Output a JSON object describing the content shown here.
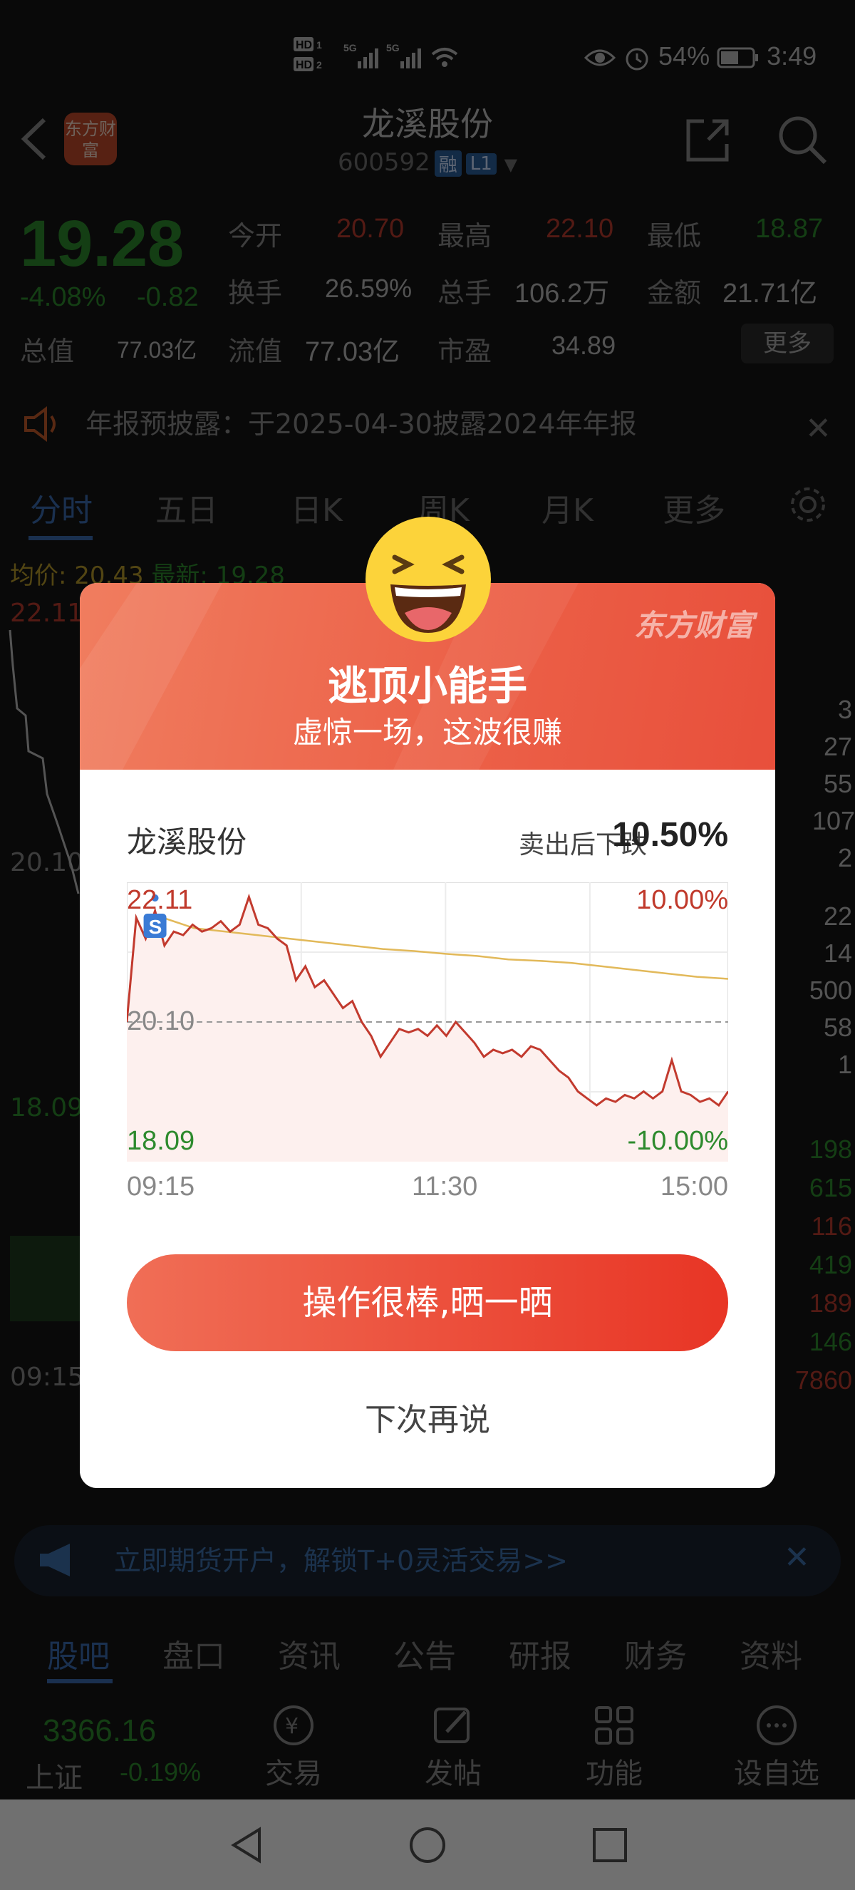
{
  "status_bar": {
    "network": "HD 5G 5G",
    "battery": "54%",
    "time": "3:49"
  },
  "header": {
    "stock_name": "龙溪股份",
    "stock_code": "600592",
    "tag_rong": "融",
    "tag_l1": "L1",
    "logo_text": "东方财富"
  },
  "quote": {
    "price": "19.28",
    "change_pct": "-4.08%",
    "change": "-0.82",
    "open_label": "今开",
    "open": "20.70",
    "high_label": "最高",
    "high": "22.10",
    "low_label": "最低",
    "low": "18.87",
    "turnover_label": "换手",
    "turnover": "26.59%",
    "volume_label": "总手",
    "volume": "106.2万",
    "amount_label": "金额",
    "amount": "21.71亿",
    "total_value_label": "总值",
    "total_value": "77.03亿",
    "float_value_label": "流值",
    "float_value": "77.03亿",
    "pe_label": "市盈",
    "pe": "34.89",
    "more": "更多"
  },
  "notice": {
    "text": "年报预披露：于2025-04-30披露2024年年报"
  },
  "chart_tabs": [
    "分时",
    "五日",
    "日K",
    "周K",
    "月K",
    "更多"
  ],
  "bg_chart": {
    "avg_label": "均价:",
    "avg": "20.43",
    "latest_label": "最新:",
    "latest": "19.28",
    "high_tick": "22.11",
    "mid_tick": "20.10",
    "low_tick": "18.09",
    "time_tick": "09:15",
    "right_numbers": [
      "3",
      "27",
      "55",
      "107",
      "2",
      "22",
      "14",
      "500",
      "58",
      "1",
      "198",
      "615",
      "116",
      "419",
      "189",
      "146",
      "7860"
    ]
  },
  "ad": {
    "text": "立即期货开户，解锁T+0灵活交易>>"
  },
  "sub_tabs": [
    "股吧",
    "盘口",
    "资讯",
    "公告",
    "研报",
    "财务",
    "资料"
  ],
  "bottom_bar": {
    "index_value": "3366.16",
    "index_name": "上证",
    "index_change": "-0.19%",
    "items": [
      "交易",
      "发帖",
      "功能",
      "设自选"
    ]
  },
  "modal": {
    "brand": "东方财富",
    "title": "逃顶小能手",
    "subtitle": "虚惊一场，这波很赚",
    "stock_name": "龙溪股份",
    "drop_label": "卖出后下跌",
    "drop_value": "10.50%",
    "share_button": "操作很棒,晒一晒",
    "later_button": "下次再说"
  },
  "chart_data": {
    "type": "line",
    "ylim": [
      18.09,
      22.11
    ],
    "y_ticks_left": [
      "22.11",
      "20.10",
      "18.09"
    ],
    "y_ticks_right": [
      "10.00%",
      "-10.00%"
    ],
    "x_ticks": [
      "09:15",
      "11:30",
      "15:00"
    ],
    "reference_price": 20.1,
    "sell_marker": {
      "label": "S",
      "x_index": 3,
      "price": 21.7
    },
    "series": [
      {
        "values": [
          20.1,
          21.6,
          21.3,
          21.7,
          21.2,
          21.4,
          21.35,
          21.5,
          21.4,
          21.45,
          21.55,
          21.4,
          21.5,
          21.9,
          21.5,
          21.45,
          21.3,
          21.2,
          20.7,
          20.9,
          20.6,
          20.7,
          20.5,
          20.3,
          20.4,
          20.1,
          19.9,
          19.6,
          19.8,
          20.0,
          19.95,
          20.0,
          19.9,
          20.05,
          19.9,
          20.1,
          19.95,
          19.8,
          19.6,
          19.7,
          19.65,
          19.7,
          19.6,
          19.75,
          19.7,
          19.55,
          19.4,
          19.3,
          19.1,
          19.0,
          18.9,
          19.0,
          18.95,
          19.05,
          19.0,
          19.1,
          19.0,
          19.1,
          19.55,
          19.1,
          19.05,
          18.95,
          19.0,
          18.9,
          19.1
        ]
      },
      {
        "values": [
          21.6,
          21.45,
          21.4,
          21.35,
          21.3,
          21.25,
          21.2,
          21.15,
          21.12,
          21.08,
          21.05,
          21.0,
          20.98,
          20.95,
          20.9,
          20.85,
          20.8,
          20.75,
          20.72
        ]
      }
    ]
  }
}
